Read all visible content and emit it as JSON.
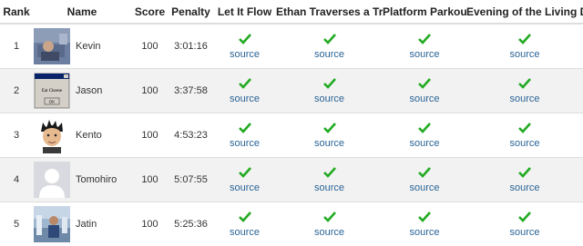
{
  "header": {
    "rank": "Rank",
    "name": "Name",
    "score": "Score",
    "penalty": "Penalty",
    "problems": [
      "Let It Flow",
      "Ethan Traverses a Tree",
      "Platform Parkour",
      "Evening of the Living Dead"
    ]
  },
  "source_label": "source",
  "colors": {
    "check": "#22aa22",
    "link": "#2a6496",
    "stripe": "#f2f2f2"
  },
  "rows": [
    {
      "rank": "1",
      "name": "Kevin",
      "score": "100",
      "penalty": "3:01:16",
      "avatar": "photo-blue-room",
      "solved": [
        true,
        true,
        true,
        true
      ]
    },
    {
      "rank": "2",
      "name": "Jason",
      "score": "100",
      "penalty": "3:37:58",
      "avatar": "eat-cheese-dialog",
      "avatar_text": {
        "title": "",
        "message": "Eat Cheese",
        "button": "OK"
      },
      "solved": [
        true,
        true,
        true,
        true
      ]
    },
    {
      "rank": "3",
      "name": "Kento",
      "score": "100",
      "penalty": "4:53:23",
      "avatar": "photo-spiky-hair",
      "solved": [
        true,
        true,
        true,
        true
      ]
    },
    {
      "rank": "4",
      "name": "Tomohiro",
      "score": "100",
      "penalty": "5:07:55",
      "avatar": "default-silhouette",
      "solved": [
        true,
        true,
        true,
        true
      ]
    },
    {
      "rank": "5",
      "name": "Jatin",
      "score": "100",
      "penalty": "5:25:36",
      "avatar": "photo-outdoor",
      "solved": [
        true,
        true,
        true,
        true
      ]
    }
  ]
}
